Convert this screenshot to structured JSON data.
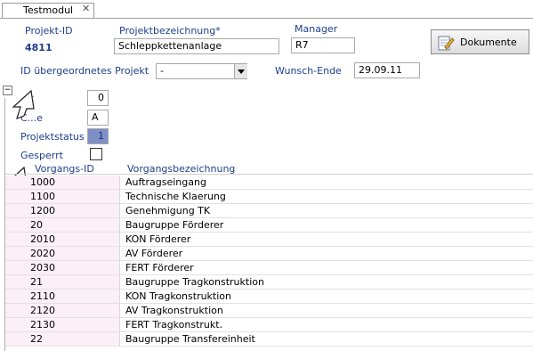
{
  "tab": {
    "label": "Testmodul",
    "close": "✕"
  },
  "header": {
    "projekt_id_label": "Projekt-ID",
    "projekt_id_value": "4811",
    "bezeichnung_label": "Projektbezeichnung*",
    "bezeichnung_value": "Schleppkettenanlage",
    "manager_label": "Manager",
    "manager_value": "R7",
    "dokumente_label": "Dokumente"
  },
  "parent": {
    "label": "ID übergeordnetes Projekt",
    "selected": "-",
    "wunsch_label": "Wunsch-Ende",
    "wunsch_value": "29.09.11"
  },
  "details": {
    "expander": "−",
    "row1_label": "...t",
    "row1_value": "0",
    "row2_label": "C...e",
    "row2_value": "A",
    "status_label": "Projektstatus",
    "status_value": "1",
    "gesperrt_label": "Gesperrt"
  },
  "grid": {
    "columns": [
      "Vorgangs-ID",
      "Vorgangsbezeichnung"
    ],
    "rows": [
      [
        "1000",
        "Auftragseingang"
      ],
      [
        "1100",
        "Technische Klaerung"
      ],
      [
        "1200",
        "Genehmigung TK"
      ],
      [
        "20",
        "Baugruppe Förderer"
      ],
      [
        "2010",
        "KON Förderer"
      ],
      [
        "2020",
        "AV Förderer"
      ],
      [
        "2030",
        "FERT Förderer"
      ],
      [
        "21",
        "Baugruppe Tragkonstruktion"
      ],
      [
        "2110",
        "KON Tragkonstruktion"
      ],
      [
        "2120",
        "AV Tragkonstruktion"
      ],
      [
        "2130",
        "FERT Tragkonstrukt."
      ],
      [
        "22",
        "Baugruppe Transfereinheit"
      ]
    ]
  }
}
